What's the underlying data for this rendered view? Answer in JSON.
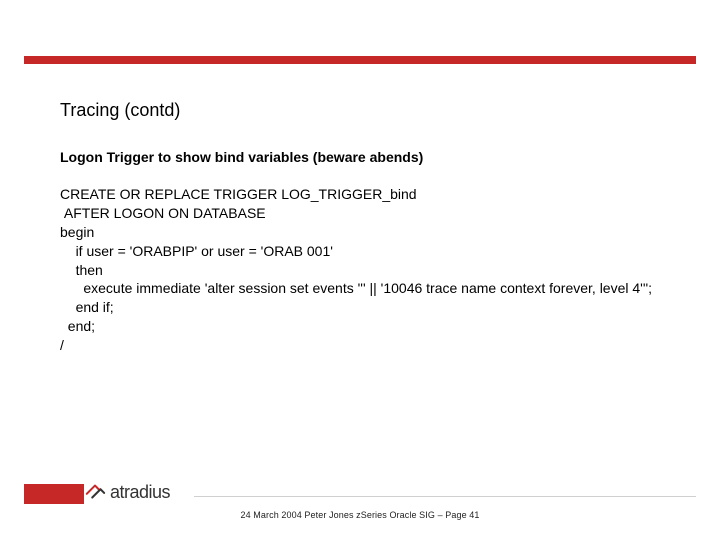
{
  "slide": {
    "title": "Tracing (contd)",
    "subhead": "Logon Trigger to show bind variables (beware abends)",
    "code": "CREATE OR REPLACE TRIGGER LOG_TRIGGER_bind\n AFTER LOGON ON DATABASE\nbegin\n    if user = 'ORABPIP' or user = 'ORAB 001'\n    then\n      execute immediate 'alter session set events ''' || '10046 trace name context forever, level 4''';\n    end if;\n  end;\n/"
  },
  "brand": {
    "name": "atradius"
  },
  "footer": {
    "text": "24 March 2004 Peter Jones zSeries Oracle SIG – Page 41"
  }
}
